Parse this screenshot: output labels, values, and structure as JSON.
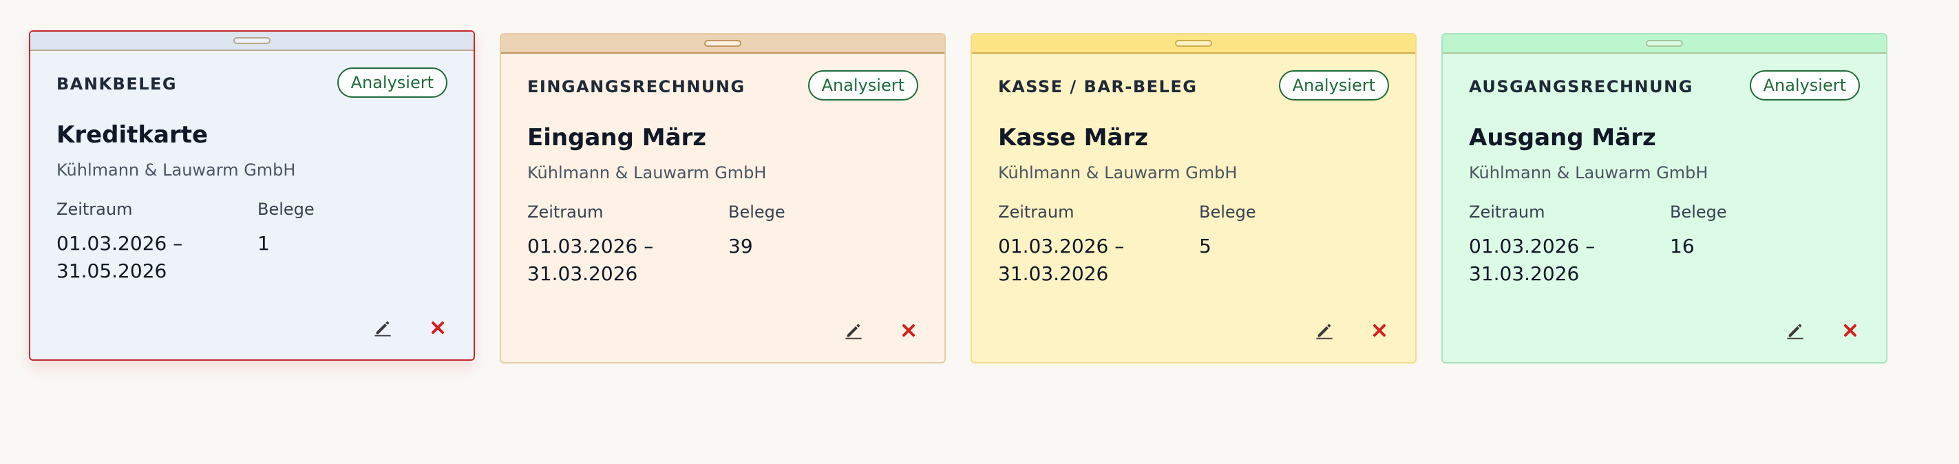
{
  "cards": [
    {
      "doc_type": "BANKBELEG",
      "status": "Analysiert",
      "title": "Kreditkarte",
      "company": "Kühlmann & Lauwarm GmbH",
      "period_label": "Zeitraum",
      "period_start": "01.03.2026 –",
      "period_end": "31.05.2026",
      "count_label": "Belege",
      "count": "1",
      "colors": {
        "body": "#eef3fa",
        "tab": "#dde5f1",
        "border": "#c62a2a",
        "handle": "#b8a88a"
      },
      "selected": true
    },
    {
      "doc_type": "EINGANGSRECHNUNG",
      "status": "Analysiert",
      "title": "Eingang März",
      "company": "Kühlmann & Lauwarm GmbH",
      "period_label": "Zeitraum",
      "period_start": "01.03.2026 –",
      "period_end": "31.03.2026",
      "count_label": "Belege",
      "count": "39",
      "colors": {
        "body": "#fef2e6",
        "tab": "#ebd3b3",
        "border": "#e5cda8",
        "handle": "#c2955c"
      },
      "selected": false
    },
    {
      "doc_type": "KASSE / BAR-BELEG",
      "status": "Analysiert",
      "title": "Kasse März",
      "company": "Kühlmann & Lauwarm GmbH",
      "period_label": "Zeitraum",
      "period_start": "01.03.2026 –",
      "period_end": "31.03.2026",
      "count_label": "Belege",
      "count": "5",
      "colors": {
        "body": "#fef3c4",
        "tab": "#fde586",
        "border": "#f1dc8d",
        "handle": "#cdad4c"
      },
      "selected": false
    },
    {
      "doc_type": "AUSGANGSRECHNUNG",
      "status": "Analysiert",
      "title": "Ausgang März",
      "company": "Kühlmann & Lauwarm GmbH",
      "period_label": "Zeitraum",
      "period_start": "01.03.2026 –",
      "period_end": "31.03.2026",
      "count_label": "Belege",
      "count": "16",
      "colors": {
        "body": "#dcfbe6",
        "tab": "#bdf5cf",
        "border": "#a9e3bd",
        "handle": "#a6c69a"
      },
      "selected": false
    }
  ],
  "icons": {
    "edit": "pencil-icon",
    "delete": "close-x-icon"
  },
  "accent_colors": {
    "status_green": "#1f6b3a",
    "delete_red": "#d42020"
  }
}
